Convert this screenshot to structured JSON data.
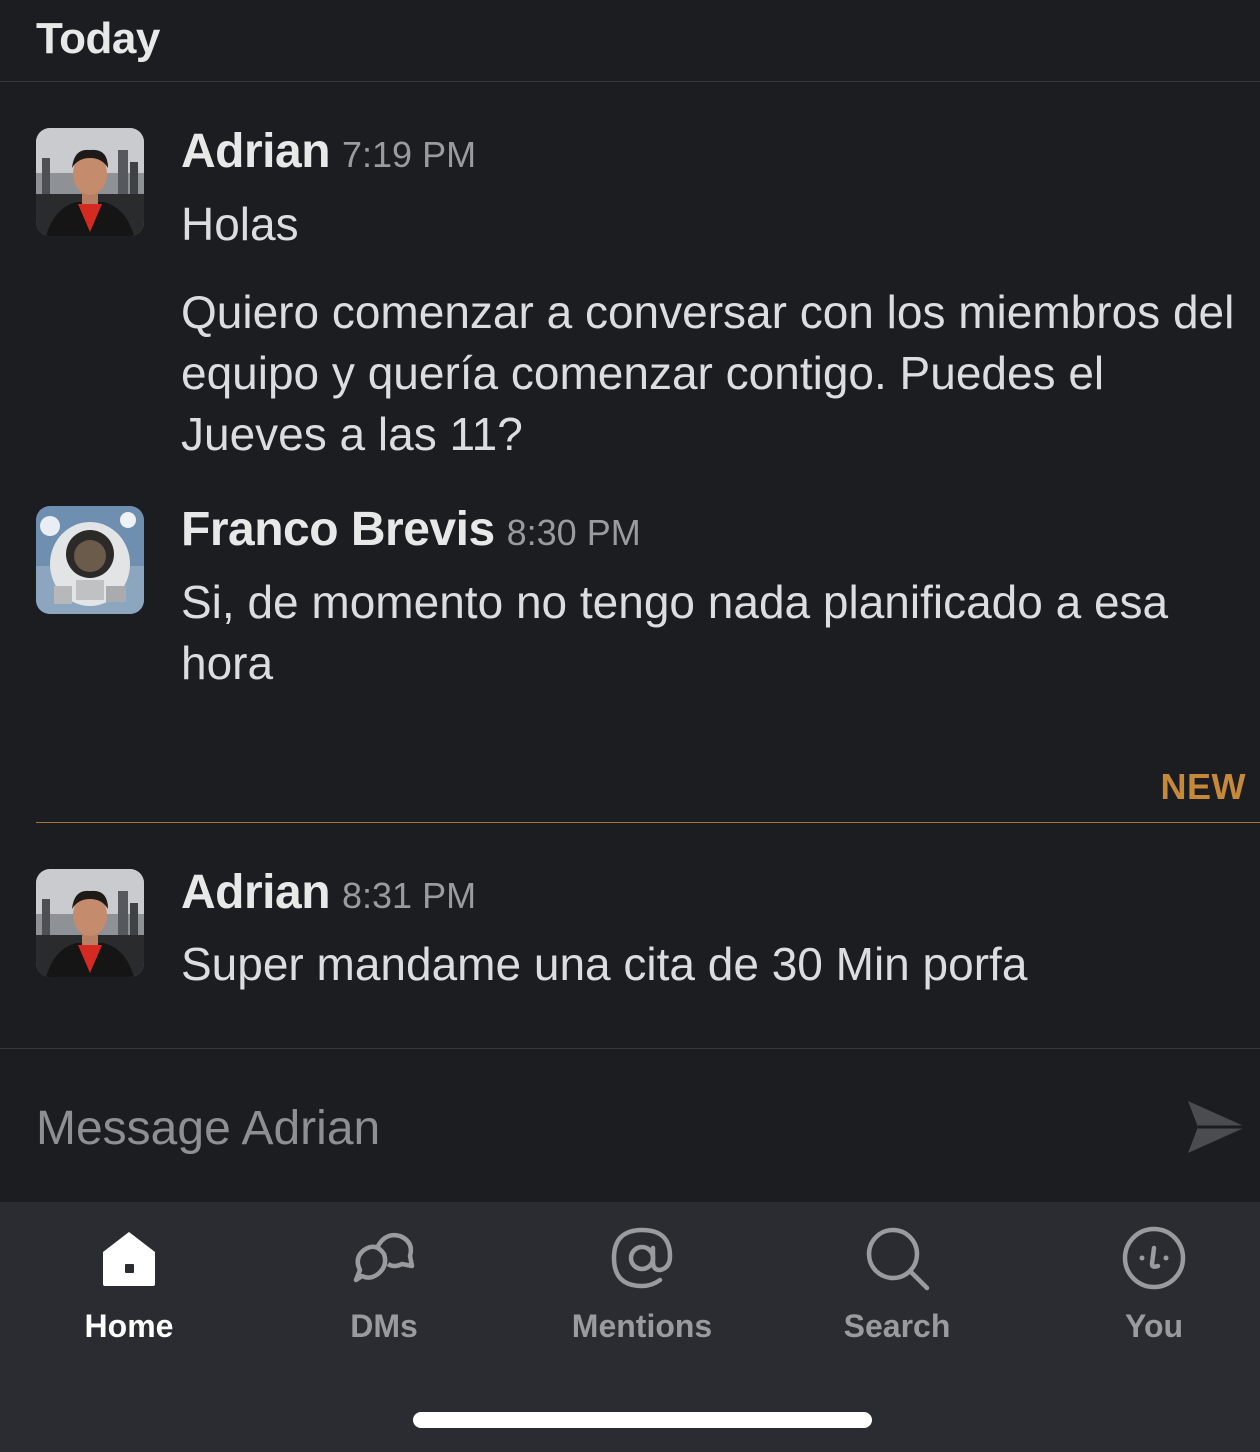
{
  "day_header": "Today",
  "messages": [
    {
      "author": "Adrian",
      "time": "7:19 PM",
      "avatar": "adrian-avatar",
      "paragraphs": [
        "Holas",
        "Quiero comenzar a conversar con los miembros del equipo y quería comenzar contigo. Puedes el Jueves a las 11?"
      ]
    },
    {
      "author": "Franco Brevis",
      "time": "8:30 PM",
      "avatar": "franco-avatar",
      "paragraphs": [
        "Si, de momento no tengo nada planificado a esa hora"
      ]
    },
    {
      "author": "Adrian",
      "time": "8:31 PM",
      "avatar": "adrian-avatar",
      "paragraphs": [
        "Super mandame una cita de 30 Min porfa"
      ]
    }
  ],
  "new_divider": "NEW",
  "composer": {
    "placeholder": "Message Adrian",
    "send_icon": "send-icon"
  },
  "tabs": [
    {
      "label": "Home",
      "icon": "home-icon",
      "active": true
    },
    {
      "label": "DMs",
      "icon": "dms-icon",
      "active": false
    },
    {
      "label": "Mentions",
      "icon": "mentions-icon",
      "active": false
    },
    {
      "label": "Search",
      "icon": "search-icon",
      "active": false
    },
    {
      "label": "You",
      "icon": "you-icon",
      "active": false
    }
  ],
  "colors": {
    "background": "#1b1d21",
    "tabbar": "#2b2c31",
    "new_accent": "#c6893a",
    "text": "#dcdddf",
    "muted": "#9a9b9e"
  }
}
